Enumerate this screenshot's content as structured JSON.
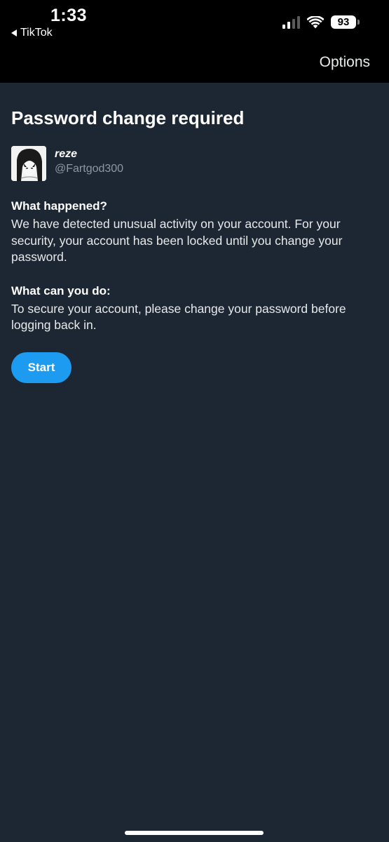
{
  "status_bar": {
    "time": "1:33",
    "back_app": "TikTok",
    "battery": "93"
  },
  "nav": {
    "options_label": "Options"
  },
  "page": {
    "title": "Password change required"
  },
  "account": {
    "display_name": "reze",
    "handle": "@Fartgod300"
  },
  "sections": [
    {
      "heading": "What happened?",
      "body": "We have detected unusual activity on your account. For your security, your account has been locked until you change your password."
    },
    {
      "heading": "What can you do:",
      "body": "To secure your account, please change your password before logging back in."
    }
  ],
  "actions": {
    "start_label": "Start"
  },
  "colors": {
    "background": "#1d2733",
    "accent": "#1d9bf0",
    "muted_text": "#8b98a5"
  },
  "icons": [
    "back-arrow-icon",
    "cellular-signal-icon",
    "wifi-icon",
    "battery-icon"
  ]
}
